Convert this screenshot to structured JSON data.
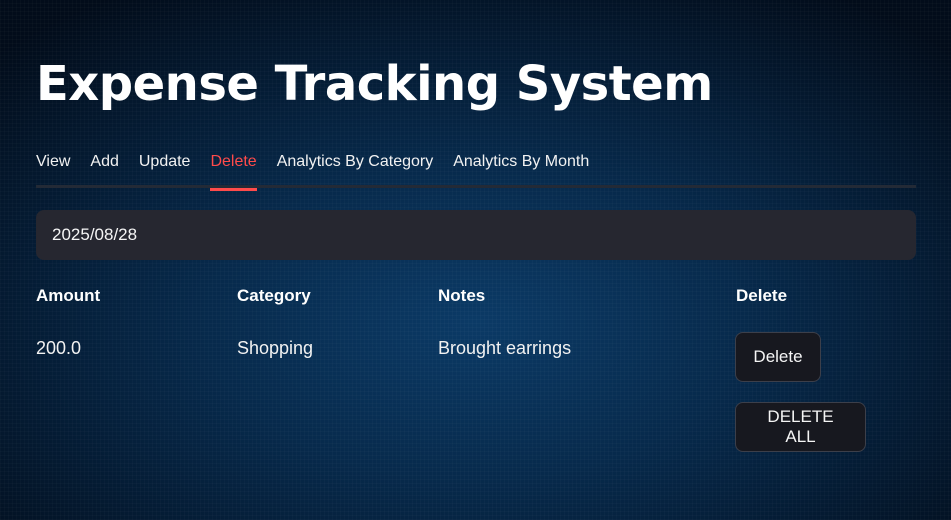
{
  "header": {
    "title": "Expense Tracking System"
  },
  "tabs": [
    {
      "label": "View",
      "active": false
    },
    {
      "label": "Add",
      "active": false
    },
    {
      "label": "Update",
      "active": false
    },
    {
      "label": "Delete",
      "active": true
    },
    {
      "label": "Analytics By Category",
      "active": false
    },
    {
      "label": "Analytics By Month",
      "active": false
    }
  ],
  "date_input": {
    "value": "2025/08/28"
  },
  "table": {
    "columns": [
      "Amount",
      "Category",
      "Notes",
      "Delete"
    ],
    "rows": [
      {
        "amount": "200.0",
        "category": "Shopping",
        "notes": "Brought earrings",
        "action_label": "Delete"
      }
    ]
  },
  "actions": {
    "delete_all_label": "DELETE ALL"
  },
  "colors": {
    "accent": "#ff4b4b",
    "input_bg": "#262730",
    "button_bg": "#17181f",
    "background": "#072a4c"
  }
}
